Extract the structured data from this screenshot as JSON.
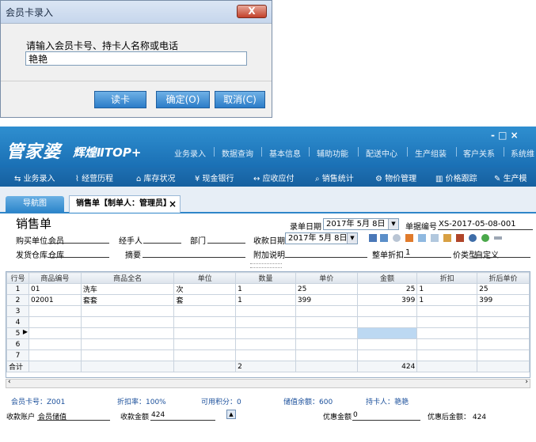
{
  "dialog": {
    "title": "会员卡录入",
    "close_label": "X",
    "prompt": "请输入会员卡号、持卡人名称或电话",
    "input_value": "艳艳",
    "buttons": {
      "read_card": "读卡",
      "ok": "确定(O)",
      "cancel": "取消(C)"
    }
  },
  "app": {
    "logo_main": "管家婆",
    "logo_sub": "辉煌ⅡTOP+",
    "window_controls": "-  □  ×",
    "top_nav": [
      "业务录入",
      "数据查询",
      "基本信息",
      "辅助功能",
      "配送中心",
      "生产组装",
      "客户关系",
      "系统维"
    ],
    "toolbar": [
      "业务录入",
      "经营历程",
      "库存状况",
      "现金银行",
      "应收应付",
      "销售统计",
      "物价管理",
      "价格跟踪",
      "生产模"
    ],
    "tabs": {
      "nav": "导航图",
      "current": "销售单【制单人：管理员】",
      "close": "×"
    }
  },
  "form": {
    "title": "销售单",
    "record_date_label": "录单日期",
    "record_date": "2017年 5月 8日",
    "doc_no_label": "单据编号",
    "doc_no": "XS-2017-05-08-001",
    "buyer_label": "购买单位",
    "buyer": "会员",
    "handler_label": "经手人",
    "dept_label": "部门",
    "pay_date_label": "收款日期",
    "pay_date": "2017年 5月 8日",
    "warehouse_label": "发货仓库",
    "warehouse": "仓库",
    "summary_label": "摘要",
    "note_label": "附加说明",
    "discount_label": "整单折扣",
    "discount": "1",
    "price_type_label": "价类型",
    "price_type": "自定义"
  },
  "grid": {
    "headers": [
      "行号",
      "商品编号",
      "商品全名",
      "单位",
      "数量",
      "单价",
      "金额",
      "折扣",
      "折后单价"
    ],
    "rows": [
      [
        "1",
        "01",
        "洗车",
        "次",
        "1",
        "25",
        "25",
        "1",
        "25"
      ],
      [
        "2",
        "02001",
        "套套",
        "套",
        "1",
        "399",
        "399",
        "1",
        "399"
      ],
      [
        "3",
        "",
        "",
        "",
        "",
        "",
        "",
        "",
        ""
      ],
      [
        "4",
        "",
        "",
        "",
        "",
        "",
        "",
        "",
        ""
      ],
      [
        "5",
        "",
        "",
        "",
        "",
        "",
        "",
        "",
        ""
      ],
      [
        "6",
        "",
        "",
        "",
        "",
        "",
        "",
        "",
        ""
      ],
      [
        "7",
        "",
        "",
        "",
        "",
        "",
        "",
        "",
        ""
      ]
    ],
    "total_label": "合计",
    "total_qty": "2",
    "total_amount": "424"
  },
  "footer": {
    "card_no": "会员卡号：Z001",
    "discount_rate": "折扣率：100%",
    "points": "可用积分：0",
    "stored_balance": "储值余额：600",
    "holder": "持卡人：艳艳",
    "pay_account_label": "收款账户",
    "pay_account": "会员储值",
    "pay_amount_label": "收款金额",
    "pay_amount": "424",
    "discount_amount_label": "优惠金额",
    "discount_amount": "0",
    "after_discount": "优惠后金额： 424"
  }
}
